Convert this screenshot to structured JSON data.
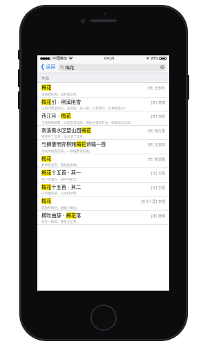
{
  "status_bar": {
    "signal": "●●●●○",
    "carrier": "中国移动",
    "wifi": "wifi-icon",
    "time": "04:16",
    "battery_percent": "93%",
    "battery_level": 0.93
  },
  "nav": {
    "back_label": "返回",
    "search_value": "梅花"
  },
  "section_header": "作品",
  "results": [
    {
      "pre": "",
      "hl": "梅花",
      "post": "",
      "author": "[宋] 王安石",
      "excerpt": "墙角数枝梅，凌寒独自开。"
    },
    {
      "pre": "",
      "hl": "梅花",
      "post": "引 · 荆溪阻雪",
      "author": "[宋] 蒋捷",
      "excerpt": "白鸥问我泊孤舟，是身留，是心留？心若留时，何事锁眉头？"
    },
    {
      "pre": "西江月 · ",
      "hl": "梅花",
      "post": "",
      "author": "[宋] 苏轼",
      "excerpt": "玉骨那愁瘴雾，冰姿自有仙风。海仙时遣探芳丛，倒挂绿毛么凤。"
    },
    {
      "pre": "南溪斋水回望山园",
      "hl": "梅花",
      "post": "",
      "author": "[宋] 杨万里",
      "excerpt": "梅花开了又开，溪水清了又清。"
    },
    {
      "pre": "与薛肇明弈棋赌",
      "hl": "梅花",
      "post": "诗输一首",
      "author": "[宋] 王安石",
      "excerpt": "华发寻春喜见梅，一株临路雪倍堆。"
    },
    {
      "pre": "",
      "hl": "梅花",
      "post": "",
      "author": "[宋] 崔道融",
      "excerpt": "数萼初含雪，孤标画本难。"
    },
    {
      "pre": "",
      "hl": "梅花",
      "post": "十五首 · 其一",
      "author": "[元] 王冕",
      "excerpt": "林下无清兴，园中尽繁华。"
    },
    {
      "pre": "",
      "hl": "梅花",
      "post": "十五首 · 其二",
      "author": "[元] 王冕",
      "excerpt": "十月霜风紧，山木俱凋零。"
    },
    {
      "pre": "",
      "hl": "梅花",
      "post": "",
      "author": "[五代十国] 李煜",
      "excerpt": "殷勤移植地，曲槛小阑边。"
    },
    {
      "pre": "横吹曲辞 · ",
      "hl": "梅花",
      "post": "落",
      "author": "[唐] 杨炯",
      "excerpt": "窗外一株梅，寒花五出开。"
    }
  ]
}
